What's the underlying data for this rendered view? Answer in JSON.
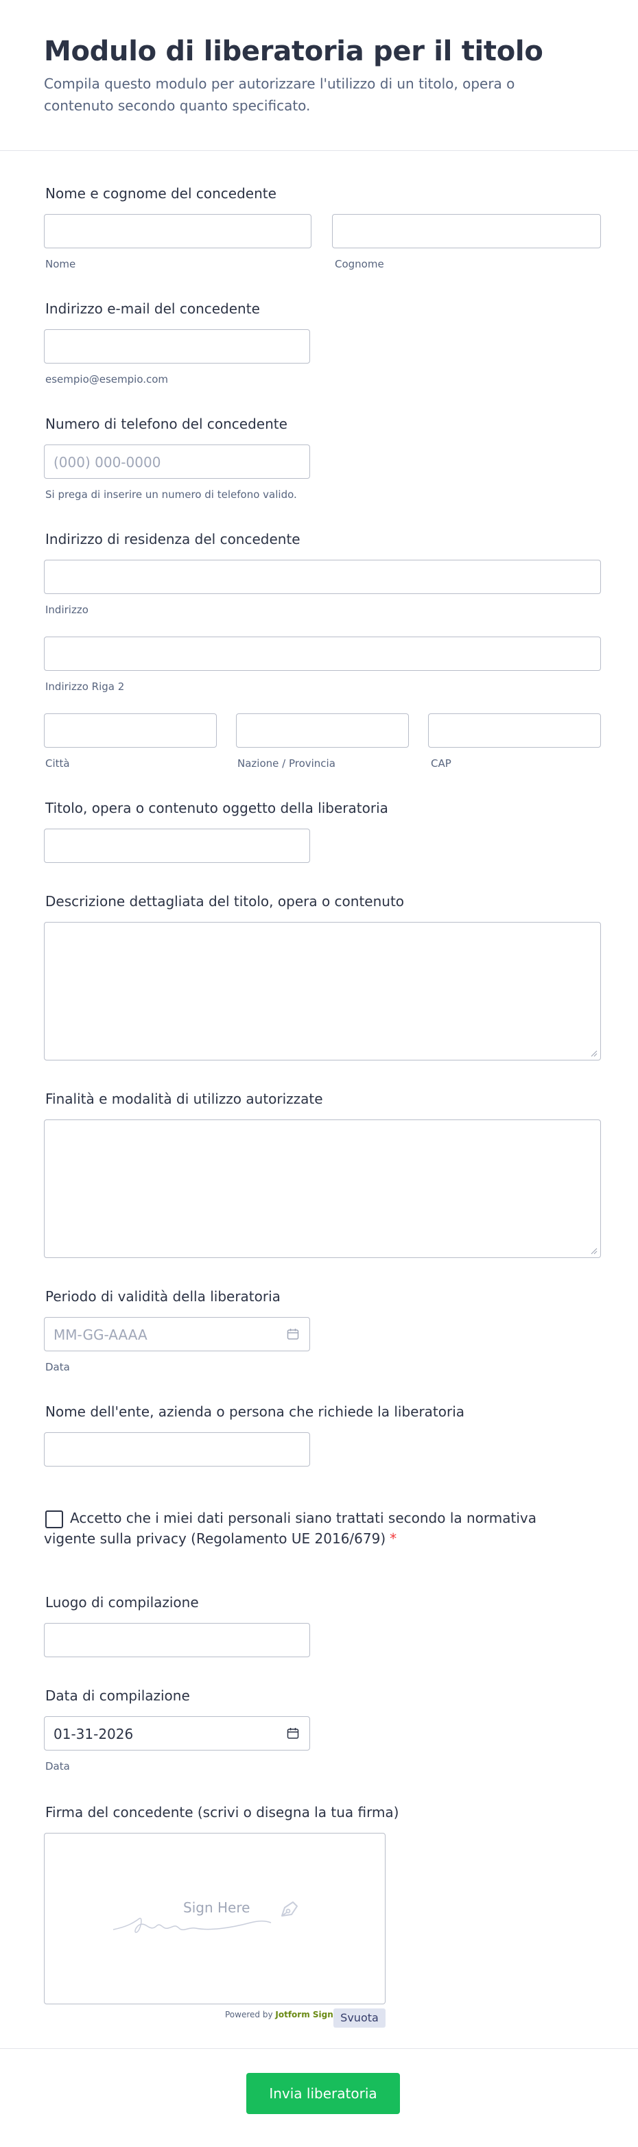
{
  "form": {
    "title": "Modulo di liberatoria per il titolo",
    "subtitle": "Compila questo modulo per autorizzare l'utilizzo di un titolo, opera o contenuto secondo quanto specificato."
  },
  "fields": {
    "name": {
      "label": "Nome e cognome del concedente",
      "first_sub": "Nome",
      "last_sub": "Cognome",
      "first_value": "",
      "last_value": ""
    },
    "email": {
      "label": "Indirizzo e-mail del concedente",
      "sub": "esempio@esempio.com",
      "value": ""
    },
    "phone": {
      "label": "Numero di telefono del concedente",
      "placeholder": "(000) 000-0000",
      "sub": "Si prega di inserire un numero di telefono valido."
    },
    "address": {
      "label": "Indirizzo di residenza del concedente",
      "street_sub": "Indirizzo",
      "street2_sub": "Indirizzo Riga 2",
      "city_sub": "Città",
      "state_sub": "Nazione / Provincia",
      "zip_sub": "CAP"
    },
    "title_item": {
      "label": "Titolo, opera o contenuto oggetto della liberatoria"
    },
    "description": {
      "label": "Descrizione dettagliata del titolo, opera o contenuto"
    },
    "purposes": {
      "label": "Finalità e modalità di utilizzo autorizzate"
    },
    "validity": {
      "label": "Periodo di validità della liberatoria",
      "placeholder": "MM-GG-AAAA",
      "sub": "Data"
    },
    "requester": {
      "label": "Nome dell'ente, azienda o persona che richiede la liberatoria"
    },
    "consent": {
      "text": "Accetto che i miei dati personali siano trattati secondo la normativa vigente sulla privacy (Regolamento UE 2016/679)",
      "required_mark": "*",
      "checked": false
    },
    "place": {
      "label": "Luogo di compilazione"
    },
    "date": {
      "label": "Data di compilazione",
      "value": "01-31-2026",
      "sub": "Data"
    },
    "signature": {
      "label": "Firma del concedente (scrivi o disegna la tua firma)",
      "placeholder": "Sign Here",
      "powered_prefix": "Powered by",
      "powered_brand": "Jotform Sign",
      "clear_label": "Svuota"
    }
  },
  "submit_label": "Invia liberatoria",
  "colors": {
    "submit": "#18bd5b",
    "required": "#f23a3c",
    "border": "#b8bdc9",
    "text": "#2c3345",
    "muted": "#57647e"
  },
  "icons": {
    "calendar": "calendar-icon",
    "pen": "pen-icon",
    "resize": "resize-handle-icon"
  }
}
